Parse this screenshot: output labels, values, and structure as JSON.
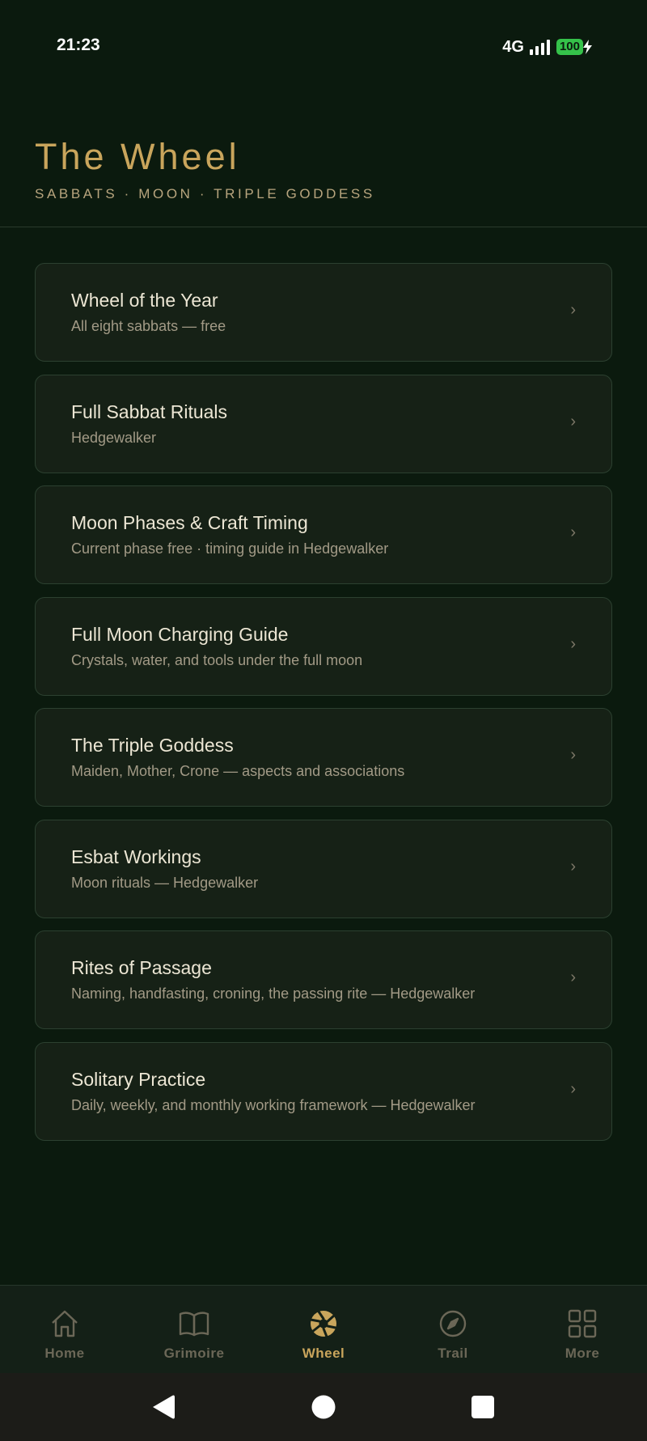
{
  "status": {
    "time": "21:23",
    "network": "4G",
    "battery": "100"
  },
  "header": {
    "title": "The Wheel",
    "subtitle": "SABBATS · MOON · TRIPLE GODDESS"
  },
  "items": [
    {
      "title": "Wheel of the Year",
      "subtitle": "All eight sabbats — free"
    },
    {
      "title": "Full Sabbat Rituals",
      "subtitle": "Hedgewalker"
    },
    {
      "title": "Moon Phases & Craft Timing",
      "subtitle": "Current phase free · timing guide in Hedgewalker"
    },
    {
      "title": "Full Moon Charging Guide",
      "subtitle": "Crystals, water, and tools under the full moon"
    },
    {
      "title": "The Triple Goddess",
      "subtitle": "Maiden, Mother, Crone — aspects and associations"
    },
    {
      "title": "Esbat Workings",
      "subtitle": "Moon rituals — Hedgewalker"
    },
    {
      "title": "Rites of Passage",
      "subtitle": "Naming, handfasting, croning, the passing rite — Hedgewalker"
    },
    {
      "title": "Solitary Practice",
      "subtitle": "Daily, weekly, and monthly working framework — Hedgewalker"
    }
  ],
  "chevron": "›",
  "tabs": [
    {
      "label": "Home",
      "icon": "home-icon",
      "active": false
    },
    {
      "label": "Grimoire",
      "icon": "book-icon",
      "active": false
    },
    {
      "label": "Wheel",
      "icon": "wheel-icon",
      "active": true
    },
    {
      "label": "Trail",
      "icon": "compass-icon",
      "active": false
    },
    {
      "label": "More",
      "icon": "grid-icon",
      "active": false
    }
  ],
  "colors": {
    "background": "#0b1a0e",
    "accent": "#c9a55c",
    "card": "#162116",
    "inactive_tab": "#6b6757"
  }
}
